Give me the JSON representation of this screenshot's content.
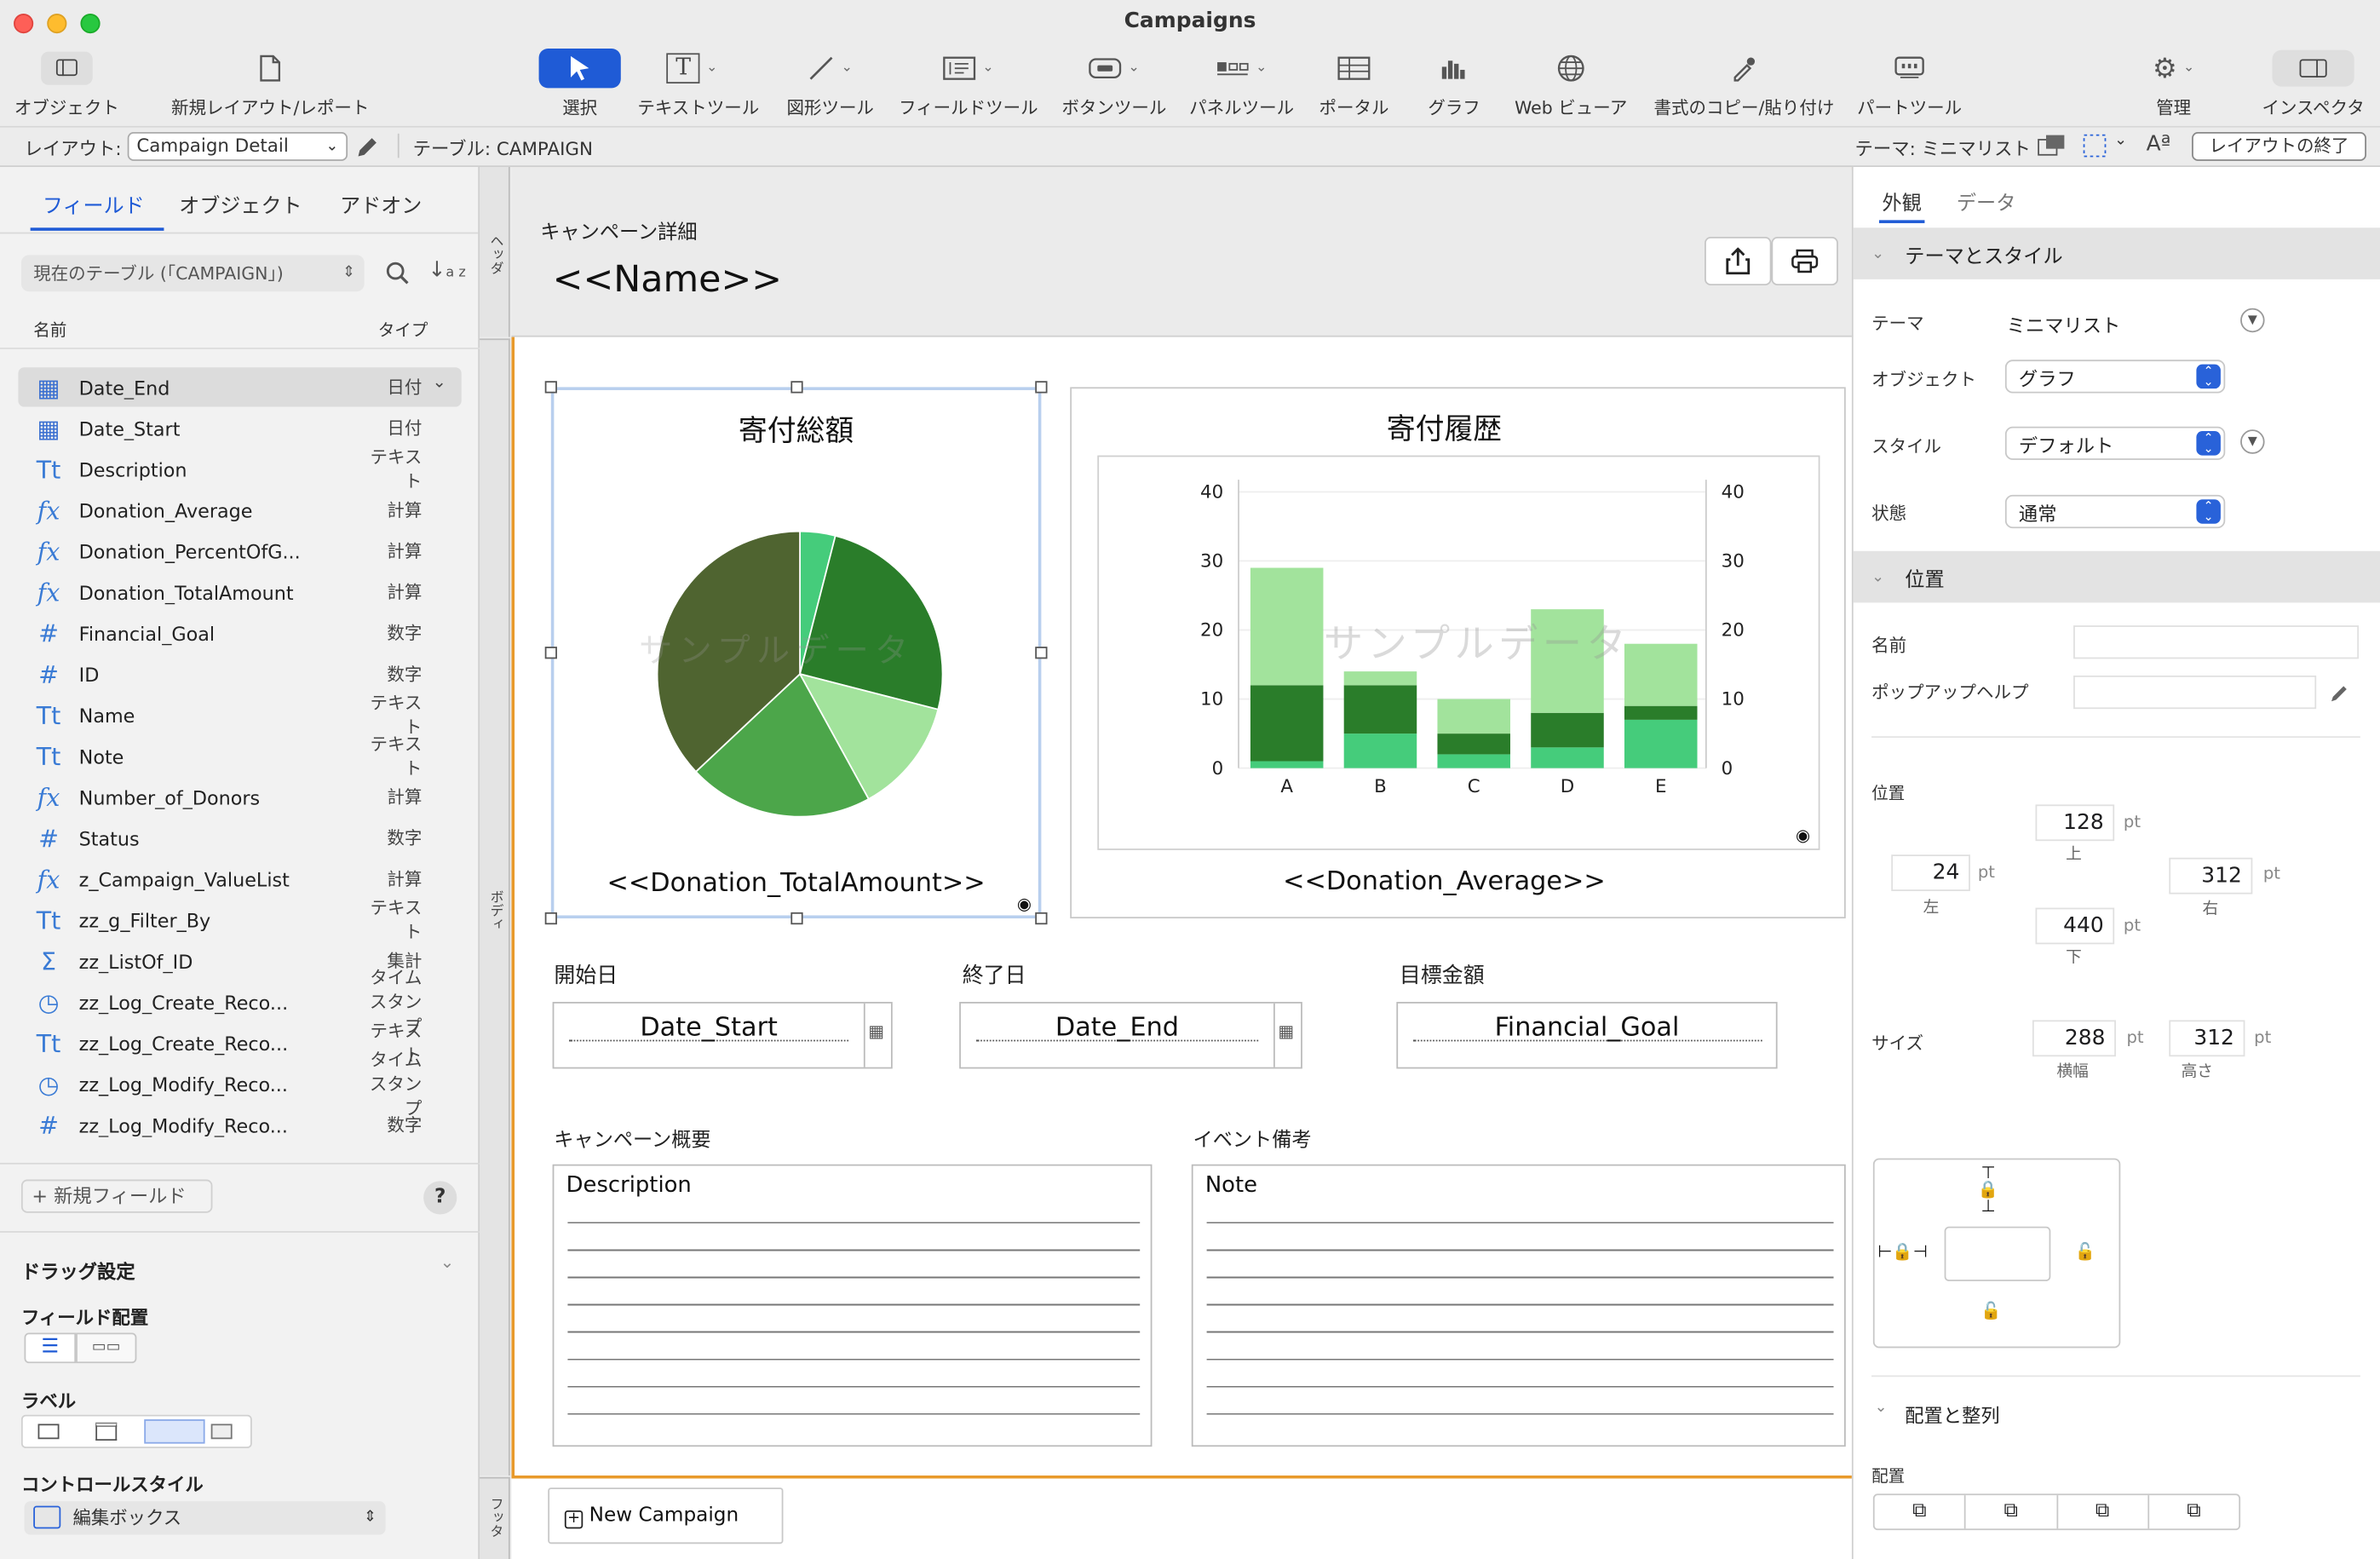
{
  "window": {
    "title": "Campaigns"
  },
  "toolbar": {
    "objects": "オブジェクト",
    "new_layout": "新規レイアウト/レポート",
    "select": "選択",
    "text_tool": "テキストツール",
    "shape_tool": "図形ツール",
    "field_tool": "フィールドツール",
    "button_tool": "ボタンツール",
    "panel_tool": "パネルツール",
    "portal": "ポータル",
    "chart": "グラフ",
    "web_viewer": "Web ビューア",
    "format_painter": "書式のコピー/貼り付け",
    "part_tool": "パートツール",
    "manage": "管理",
    "inspector": "インスペクタ"
  },
  "layoutbar": {
    "layout_label": "レイアウト:",
    "layout_value": "Campaign Detail",
    "table_label": "テーブル: CAMPAIGN",
    "theme_label": "テーマ: ミニマリスト",
    "font_glyph": "Aª",
    "exit_button": "レイアウトの終了"
  },
  "leftpane": {
    "tabs": [
      "フィールド",
      "オブジェクト",
      "アドオン"
    ],
    "table_select": "現在のテーブル (「CAMPAIGN」)",
    "col_name": "名前",
    "col_type": "タイプ",
    "fields": [
      {
        "icon": "calendar",
        "name": "Date_End",
        "type": "日付"
      },
      {
        "icon": "calendar",
        "name": "Date_Start",
        "type": "日付"
      },
      {
        "icon": "text",
        "name": "Description",
        "type": "テキスト"
      },
      {
        "icon": "calc",
        "name": "Donation_Average",
        "type": "計算"
      },
      {
        "icon": "calc",
        "name": "Donation_PercentOfG...",
        "type": "計算"
      },
      {
        "icon": "calc",
        "name": "Donation_TotalAmount",
        "type": "計算"
      },
      {
        "icon": "number",
        "name": "Financial_Goal",
        "type": "数字"
      },
      {
        "icon": "number",
        "name": "ID",
        "type": "数字"
      },
      {
        "icon": "text",
        "name": "Name",
        "type": "テキスト"
      },
      {
        "icon": "text",
        "name": "Note",
        "type": "テキスト"
      },
      {
        "icon": "calc",
        "name": "Number_of_Donors",
        "type": "計算"
      },
      {
        "icon": "number",
        "name": "Status",
        "type": "数字"
      },
      {
        "icon": "calc",
        "name": "z_Campaign_ValueList",
        "type": "計算"
      },
      {
        "icon": "text",
        "name": "zz_g_Filter_By",
        "type": "テキスト"
      },
      {
        "icon": "summary",
        "name": "zz_ListOf_ID",
        "type": "集計"
      },
      {
        "icon": "timestamp",
        "name": "zz_Log_Create_Reco...",
        "type": "タイムスタンプ"
      },
      {
        "icon": "text",
        "name": "zz_Log_Create_Reco...",
        "type": "テキスト"
      },
      {
        "icon": "timestamp",
        "name": "zz_Log_Modify_Reco...",
        "type": "タイムスタンプ"
      },
      {
        "icon": "number",
        "name": "zz_Log_Modify_Reco...",
        "type": "数字"
      }
    ],
    "new_field": "+ 新規フィールド",
    "help": "?",
    "drag_settings": "ドラッグ設定",
    "field_placement": "フィールド配置",
    "label": "ラベル",
    "control_style": "コントロールスタイル",
    "control_value": "編集ボックス"
  },
  "rulers": {
    "header": "ヘッダ",
    "body": "ボディ",
    "footer": "フッタ"
  },
  "canvas": {
    "header_subtitle": "キャンペーン詳細",
    "header_name": "<<Name>>",
    "pie_title": "寄付総額",
    "pie_field": "<<Donation_TotalAmount>>",
    "bar_title": "寄付履歴",
    "bar_field": "<<Donation_Average>>",
    "sample_text": "サンプルデータ",
    "start_label": "開始日",
    "start_field": "Date_Start",
    "end_label": "終了日",
    "end_field": "Date_End",
    "goal_label": "目標金額",
    "goal_field": "Financial_Goal",
    "desc_label": "キャンペーン概要",
    "desc_field": "Description",
    "note_label": "イベント備考",
    "note_field": "Note",
    "new_campaign": "New Campaign"
  },
  "chart_data": [
    {
      "type": "pie",
      "title": "寄付総額",
      "values": [
        4,
        25,
        13,
        21,
        37
      ],
      "colors": [
        "#45cc7b",
        "#2a7d2a",
        "#a2e39c",
        "#4ca64a",
        "#4f6430"
      ]
    },
    {
      "type": "bar",
      "title": "寄付履歴",
      "categories": [
        "A",
        "B",
        "C",
        "D",
        "E"
      ],
      "ylim": [
        0,
        40
      ],
      "yticks": [
        0,
        10,
        20,
        30,
        40
      ],
      "series": [
        {
          "values": [
            1,
            5,
            2,
            3,
            7
          ],
          "color": "#45cc7b"
        },
        {
          "values": [
            11,
            7,
            3,
            5,
            2
          ],
          "color": "#2a7d2a"
        },
        {
          "values": [
            17,
            2,
            5,
            15,
            9
          ],
          "color": "#a2e39c"
        }
      ]
    }
  ],
  "inspector": {
    "tabs": [
      "外観",
      "データ"
    ],
    "theme_section": "テーマとスタイル",
    "theme_label": "テーマ",
    "theme_value": "ミニマリスト",
    "object_label": "オブジェクト",
    "object_value": "グラフ",
    "style_label": "スタイル",
    "style_value": "デフォルト",
    "state_label": "状態",
    "state_value": "通常",
    "position_section": "位置",
    "name_label": "名前",
    "popup_help_label": "ポップアップヘルプ",
    "position_label": "位置",
    "top": "128",
    "top_label": "上",
    "left": "24",
    "left_label": "左",
    "right": "312",
    "right_label": "右",
    "bottom": "440",
    "bottom_label": "下",
    "size_label": "サイズ",
    "width": "288",
    "width_label": "横幅",
    "height": "312",
    "height_label": "高さ",
    "unit": "pt",
    "arrange_section": "配置と整列",
    "arrange_label": "配置"
  }
}
